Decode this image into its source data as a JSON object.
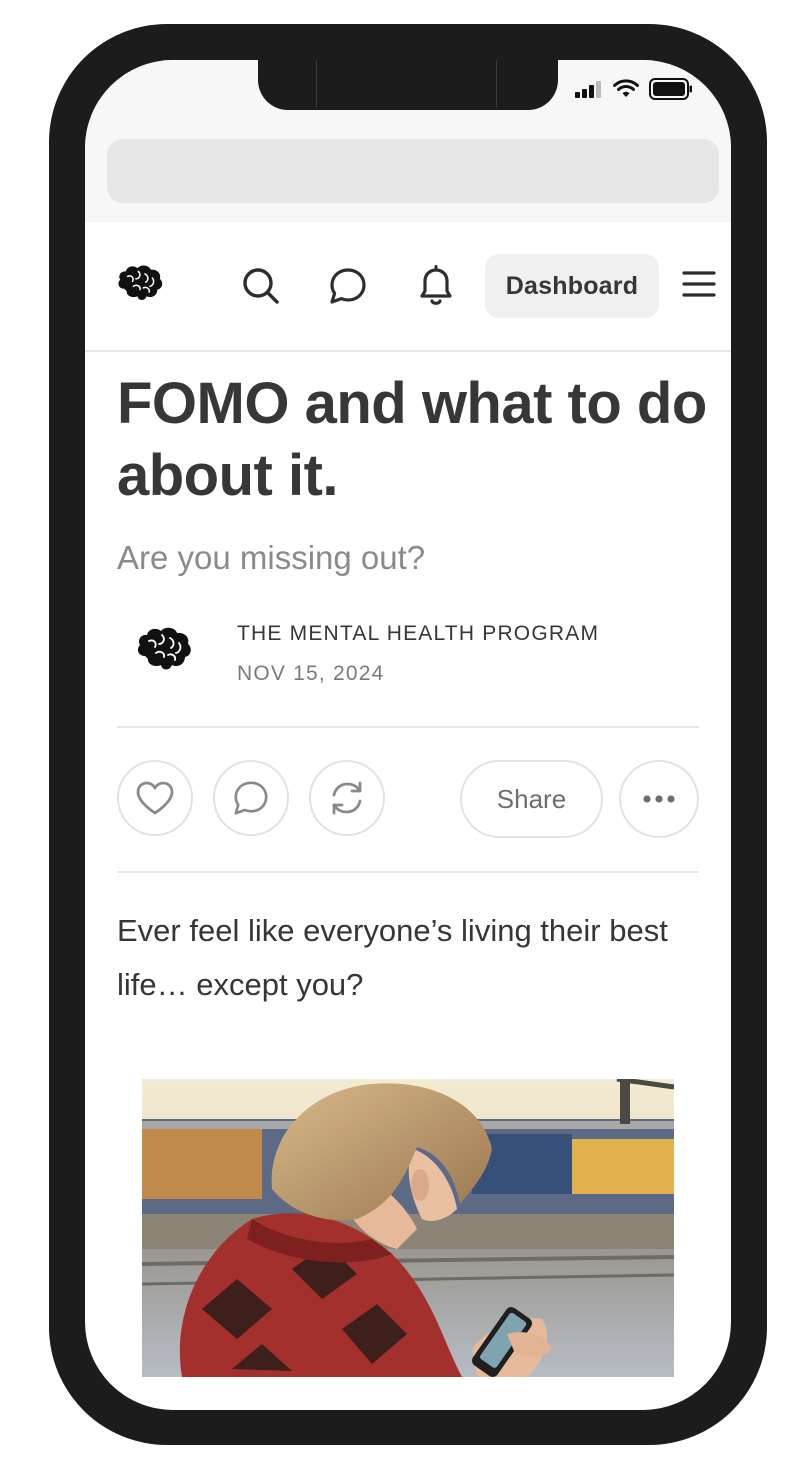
{
  "header": {
    "dashboard_label": "Dashboard"
  },
  "article": {
    "title": "FOMO and what to do about it.",
    "subtitle": "Are you missing out?",
    "author": "THE MENTAL HEALTH PROGRAM",
    "date": "NOV 15, 2024",
    "share_label": "Share",
    "body": "Ever feel like everyone’s living their best life… except you?"
  },
  "icons": {
    "logo": "brain-icon",
    "nav": [
      "search-icon",
      "chat-icon",
      "bell-icon",
      "hamburger-menu-icon"
    ],
    "actions": [
      "heart-icon",
      "comment-icon",
      "restack-icon",
      "more-icon"
    ],
    "status": [
      "cellular-signal-icon",
      "wifi-icon",
      "battery-icon"
    ]
  },
  "colors": {
    "frame": "#1c1c1c",
    "text": "#363737",
    "muted": "#8a8a8a",
    "button_bg": "#f0f0f0"
  }
}
